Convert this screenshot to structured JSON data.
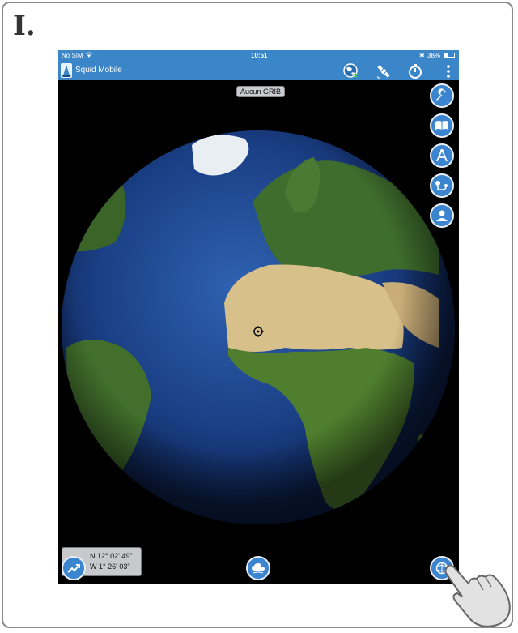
{
  "step": {
    "label": "I."
  },
  "status_bar": {
    "carrier": "No SIM",
    "time": "10:51",
    "battery": "38%"
  },
  "app": {
    "title": "Squid Mobile"
  },
  "toolbar": {
    "icons": [
      "globe-wifi-icon",
      "satellite-icon",
      "stopwatch-icon",
      "more-vert-icon"
    ]
  },
  "map": {
    "grib_label": "Aucun GRIB"
  },
  "side_tools": [
    "wrench-icon",
    "book-icon",
    "compass-icon",
    "route-icon",
    "user-icon"
  ],
  "coords": {
    "lat": "N 12° 02' 49\"",
    "lon": "W 1° 26' 03\""
  },
  "colors": {
    "accent": "#3a86c8",
    "button": "#3b84d0"
  }
}
